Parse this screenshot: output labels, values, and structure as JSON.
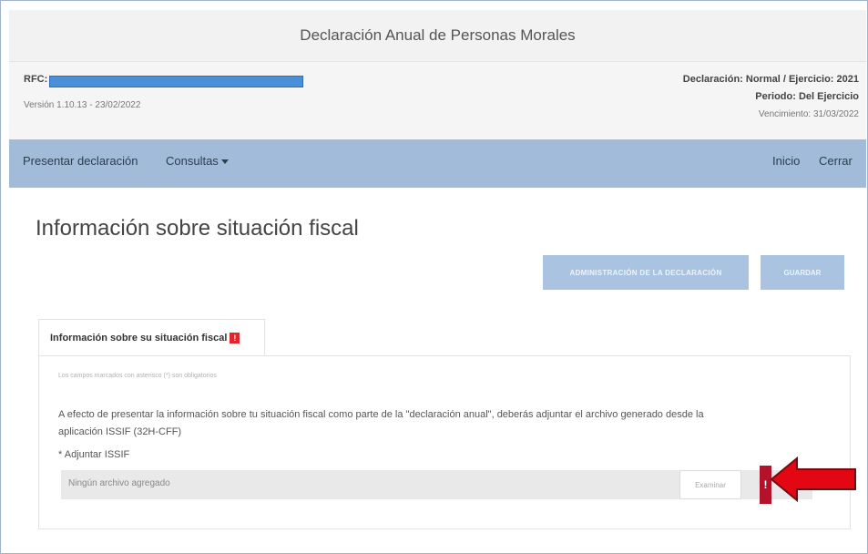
{
  "app": {
    "title": "Declaración Anual de Personas Morales"
  },
  "info": {
    "rfc_label": "RFC:",
    "version": "Versión 1.10.13 - 23/02/2022",
    "declaracion": "Declaración: Normal / Ejercicio: 2021",
    "periodo": "Periodo: Del Ejercicio",
    "vencimiento": "Vencimiento: 31/03/2022"
  },
  "nav": {
    "presentar": "Presentar declaración",
    "consultas": "Consultas",
    "inicio": "Inicio",
    "cerrar": "Cerrar"
  },
  "page": {
    "title": "Información sobre situación fiscal",
    "admin_button": "ADMINISTRACIÓN DE LA DECLARACIÓN",
    "guardar_button": "GUARDAR"
  },
  "tab": {
    "label": "Información sobre su situación fiscal",
    "badge": "!"
  },
  "form": {
    "required_note": "Los campos marcados con asterisco (*) son obligatorios",
    "description": "A efecto de presentar la información sobre tu situación fiscal como parte de la \"declaración anual\", deberás adjuntar el archivo generado desde la aplicación ISSIF (32H-CFF)",
    "attach_label": "* Adjuntar ISSIF",
    "file_placeholder": "Ningún archivo agregado",
    "examinar_button": "Examinar",
    "error_icon": "!"
  },
  "colors": {
    "nav_bg": "#a2bbd8",
    "button_disabled": "#a9c3e0",
    "error": "#b3122b",
    "arrow": "#e30613",
    "rfc_redaction": "#4a90d9"
  }
}
